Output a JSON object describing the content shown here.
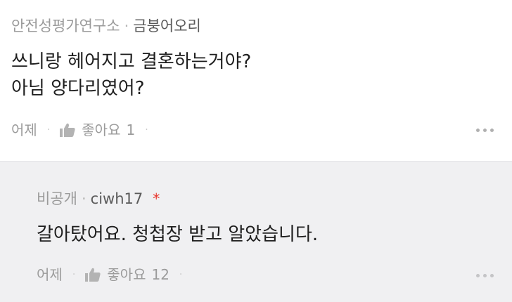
{
  "comment": {
    "group": "안전성평가연구소",
    "author": "금붕어오리",
    "lines": [
      "쓰니랑 헤어지고 결혼하는거야?",
      "아님 양다리였어?"
    ],
    "time": "어제",
    "like_label": "좋아요",
    "like_count": "1"
  },
  "reply": {
    "group": "비공개",
    "author": "ciwh17",
    "author_marker": "*",
    "text": "갈아탔어요. 청첩장 받고 알았습니다.",
    "time": "어제",
    "like_label": "좋아요",
    "like_count": "12"
  },
  "separator": "·",
  "icons": {
    "like": "thumbs-up-icon",
    "more": "more-dots-icon"
  },
  "colors": {
    "reply_background": "#f0f0f2",
    "author_marker": "#e8332a",
    "meta_text": "#9b9b9b"
  }
}
